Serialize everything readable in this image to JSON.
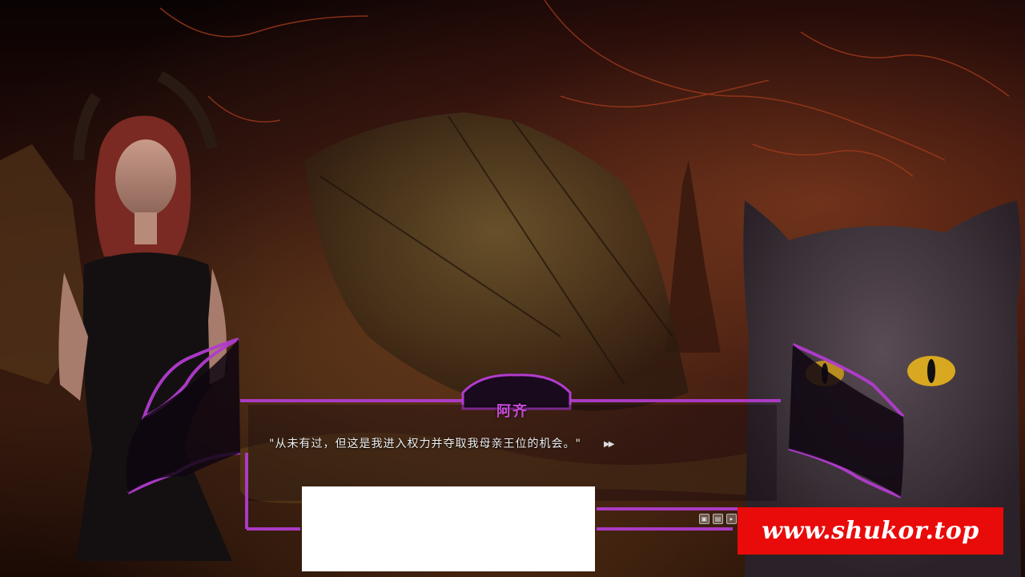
{
  "dialogue": {
    "speaker": "阿齐",
    "text": "\"从未有过，但这是我进入权力并夺取我母亲王位的机会。\"",
    "advance_icon": "fast-forward-icon"
  },
  "controls": {
    "icons": [
      "save-icon",
      "load-icon",
      "skip-icon"
    ]
  },
  "watermark": {
    "text": "www.shukor.top"
  },
  "colors": {
    "frame_accent": "#b13ccd",
    "name_color": "#c74ad8",
    "watermark_bg": "#e90a0a"
  }
}
